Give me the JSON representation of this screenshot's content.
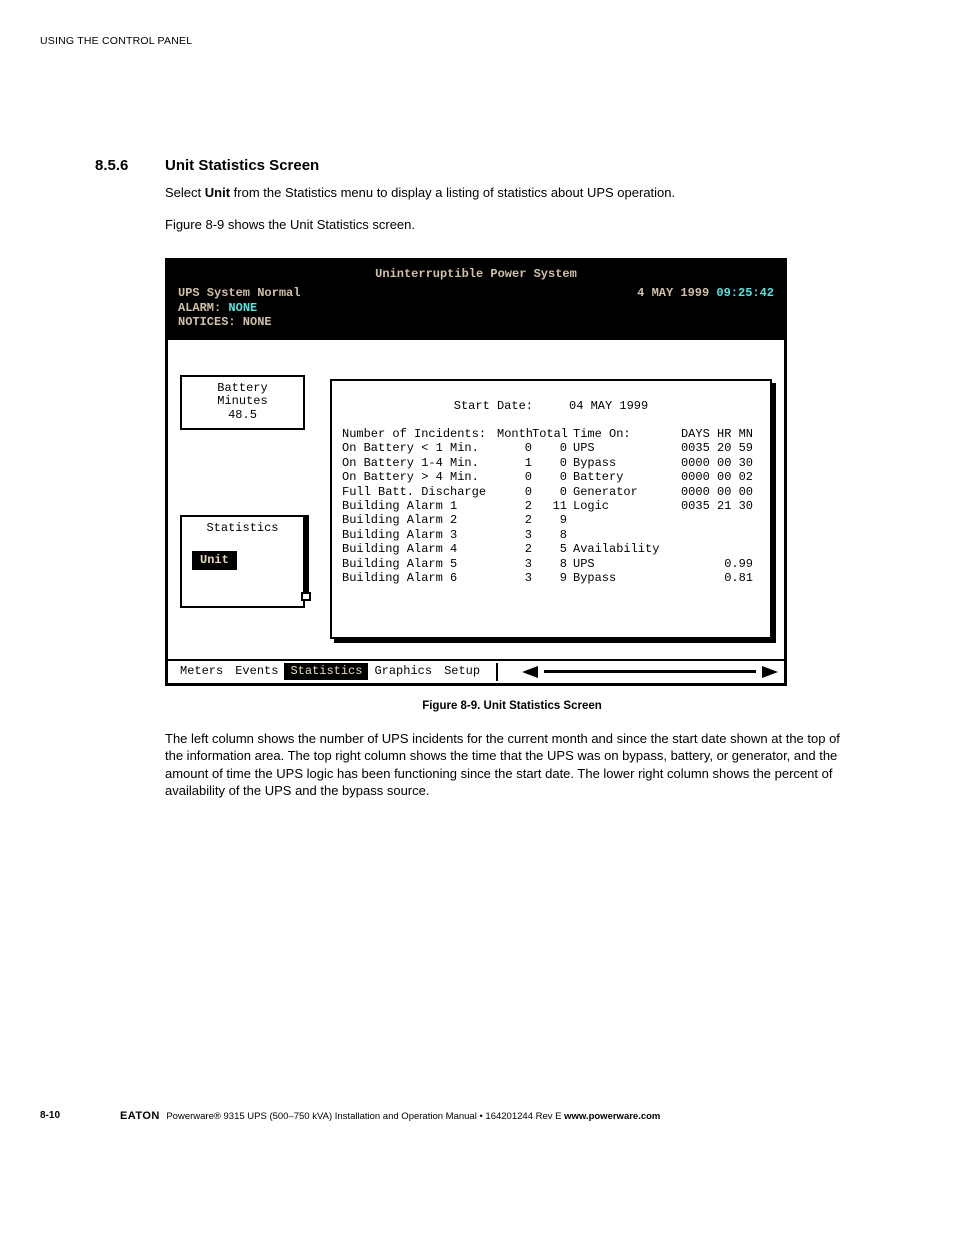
{
  "running_header": "USING THE CONTROL PANEL",
  "section_num": "8.5.6",
  "section_title": "Unit Statistics Screen",
  "intro_pre": "Select ",
  "intro_bold": "Unit",
  "intro_post": " from the Statistics menu to display a listing of statistics about UPS operation.",
  "fig_ref": "Figure 8-9 shows the Unit Statistics screen.",
  "ups": {
    "title": "Uninterruptible Power System",
    "status1": "UPS System Normal",
    "alarm_label": "ALARM:",
    "alarm_value": "NONE",
    "notices": "NOTICES: NONE",
    "date": "4 MAY 1999",
    "time": "09:25:42",
    "bm_l1": "Battery",
    "bm_l2": "Minutes",
    "bm_l3": "48.5",
    "stats_label": "Statistics",
    "unit_label": "Unit",
    "start_date_label": "Start Date:",
    "start_date_value": "04 MAY 1999",
    "hdr_incidents": "Number of Incidents:",
    "hdr_month": "Month",
    "hdr_total": "Total",
    "hdr_timeon": "Time On:",
    "hdr_dhm": "DAYS HR MN",
    "incidents": [
      {
        "label": "On Battery < 1 Min.",
        "m": "0",
        "t": "0"
      },
      {
        "label": "On Battery 1-4 Min.",
        "m": "1",
        "t": "0"
      },
      {
        "label": "On Battery > 4 Min.",
        "m": "0",
        "t": "0"
      },
      {
        "label": "Full Batt. Discharge",
        "m": "0",
        "t": "0"
      },
      {
        "label": "Building Alarm 1",
        "m": "2",
        "t": "11"
      },
      {
        "label": "Building Alarm 2",
        "m": "2",
        "t": "9"
      },
      {
        "label": "Building Alarm 3",
        "m": "3",
        "t": "8"
      },
      {
        "label": "Building Alarm 4",
        "m": "2",
        "t": "5"
      },
      {
        "label": "Building Alarm 5",
        "m": "3",
        "t": "8"
      },
      {
        "label": "Building Alarm 6",
        "m": "3",
        "t": "9"
      }
    ],
    "timeon": [
      {
        "label": "UPS",
        "dhm": "0035 20 59"
      },
      {
        "label": "Bypass",
        "dhm": "0000 00 30"
      },
      {
        "label": "Battery",
        "dhm": "0000 00 02"
      },
      {
        "label": "Generator",
        "dhm": "0000 00 00"
      },
      {
        "label": "Logic",
        "dhm": "0035 21 30"
      }
    ],
    "avail_hdr": "Availability",
    "avail": [
      {
        "label": "UPS",
        "val": "0.99"
      },
      {
        "label": "Bypass",
        "val": "0.81"
      }
    ],
    "menu": [
      "Meters",
      "Events",
      "Statistics",
      "Graphics",
      "Setup"
    ]
  },
  "fig_caption": "Figure 8-9. Unit Statistics Screen",
  "after_para": "The left column shows the number of UPS incidents for the current month and since the start date shown at the top of the information area. The top right column shows the time that the UPS was on bypass, battery, or generator, and the amount of time the UPS logic has been functioning since the start date. The lower right column shows the percent of availability of the UPS and the bypass source.",
  "footer": {
    "pageno": "8-10",
    "brand": "EATON",
    "mid": " Powerware® 9315 UPS (500–750 kVA) Installation and Operation Manual  •  164201244 Rev E  ",
    "url": "www.powerware.com"
  }
}
